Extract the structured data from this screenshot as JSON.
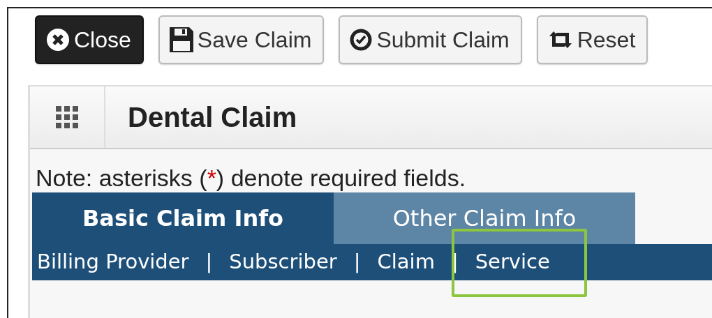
{
  "toolbar": [
    {
      "label": "Close",
      "kind": "close",
      "primary": true
    },
    {
      "label": "Save Claim",
      "kind": "save",
      "primary": false
    },
    {
      "label": "Submit Claim",
      "kind": "submit",
      "primary": false
    },
    {
      "label": "Reset",
      "kind": "reset",
      "primary": false
    }
  ],
  "panel": {
    "title": "Dental Claim"
  },
  "note": {
    "before": "Note: asterisks (",
    "asterisk": "*",
    "after": ") denote required fields."
  },
  "tabs": [
    {
      "label": "Basic Claim Info",
      "selected": true
    },
    {
      "label": "Other Claim Info",
      "selected": false
    }
  ],
  "subnav": [
    {
      "kind": "link",
      "label": "Billing Provider",
      "highlighted": false
    },
    {
      "kind": "separator",
      "label": "|",
      "highlighted": false
    },
    {
      "kind": "link",
      "label": "Subscriber",
      "highlighted": false
    },
    {
      "kind": "separator",
      "label": "|",
      "highlighted": false
    },
    {
      "kind": "link",
      "label": "Claim",
      "highlighted": false
    },
    {
      "kind": "separator",
      "label": "|",
      "highlighted": false
    },
    {
      "kind": "link",
      "label": "Service",
      "highlighted": true
    }
  ]
}
